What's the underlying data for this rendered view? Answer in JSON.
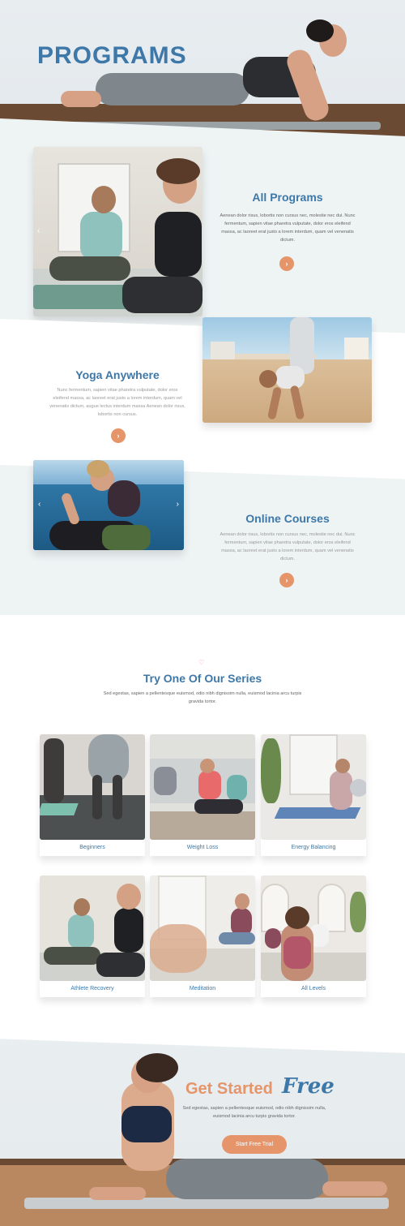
{
  "hero": {
    "title": "PROGRAMS"
  },
  "sections": [
    {
      "title": "All Programs",
      "text": "Aenean dolor risus, lobortis non cursus nec, molestie nec dui. Nunc fermentum, sapien vitae pharetra vulputate, dolor eros eleifend massa, ac laoreet erat justo a lorem interdum, quam vel venenatis dictum.",
      "button_icon": "chevron-right-icon"
    },
    {
      "title": "Yoga Anywhere",
      "text": "Nunc fermentum, sapien vitae pharetra vulputate, dolor eros eleifend massa, ac laoreet erat justo a lorem interdum, quam vel venenatis dictum, augue lectus interdum massa Aenean dolor risus, lobortis non cursus.",
      "button_icon": "chevron-right-icon"
    },
    {
      "title": "Online Courses",
      "text": "Aenean dolor risus, lobortis non cursus nec, molestie nec dui. Nunc fermentum, sapien vitae pharetra vulputate, dolor eros eleifend massa, ac laoreet erat justo a lorem interdum, quam vel venenatis dictum.",
      "button_icon": "chevron-right-icon",
      "slider_prev": "‹",
      "slider_next": "›"
    }
  ],
  "series": {
    "heart_icon": "heart-icon",
    "title": "Try One Of Our Series",
    "text": "Sed egestas, sapien a pellentesque euismod, odio nibh dignissim nulla, euismod lacinia arcu turpis gravida tortor.",
    "cards": [
      {
        "label": "Beginners"
      },
      {
        "label": "Weight Loss"
      },
      {
        "label": "Energy Balancing"
      },
      {
        "label": "Athlete Recovery"
      },
      {
        "label": "Meditation"
      },
      {
        "label": "All Levels"
      }
    ]
  },
  "cta": {
    "title": "Get Started",
    "title_accent": "Free",
    "text": "Sed egestas, sapien a pellentesque euismod, odio nibh dignissim nulla, euismod lacinia arcu turpis gravida tortor.",
    "button": "Start Free Trial"
  },
  "colors": {
    "accent": "#e6956b",
    "primary": "#3d78a8",
    "background": "#eef3f4"
  }
}
